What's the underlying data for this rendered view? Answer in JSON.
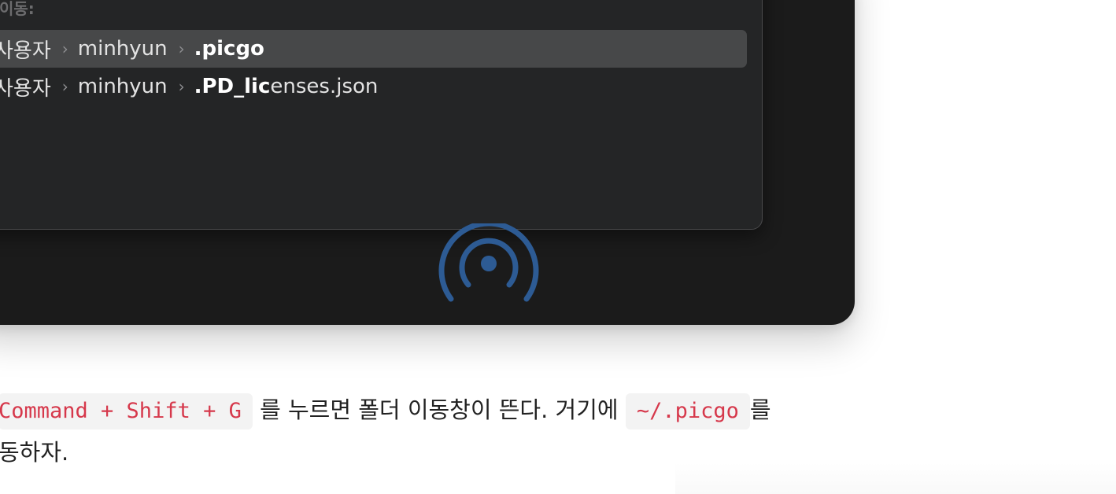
{
  "go_to_folder": {
    "label": "이동:",
    "results": [
      {
        "path": [
          "사용자",
          "minhyun"
        ],
        "name_highlight": ".picgo",
        "name_rest": "",
        "selected": true
      },
      {
        "path": [
          "사용자",
          "minhyun"
        ],
        "name_highlight": ".PD_lic",
        "name_rest": "enses.json",
        "selected": false
      }
    ]
  },
  "airdrop": {
    "icon": "airdrop-icon",
    "color": "#2d5b94"
  },
  "article": {
    "code_shortcut": "Command + Shift + G",
    "text_1": "를 누르면 폴더 이동창이 뜬다. 거기에",
    "code_path": "~/.picgo",
    "text_2": "를",
    "line2_text": "동하자."
  },
  "colors": {
    "code_text": "#d6384b",
    "code_bg": "#f3f3f3",
    "sheet_bg": "#242526",
    "selected_row": "#474849"
  }
}
